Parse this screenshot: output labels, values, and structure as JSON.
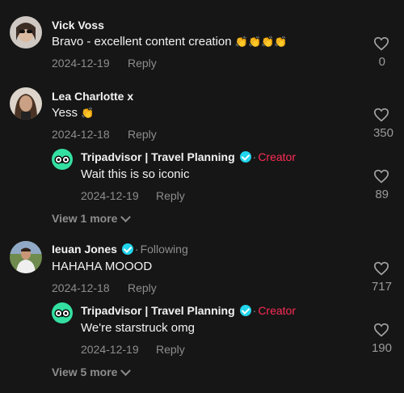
{
  "comments": [
    {
      "author": "Vick Voss",
      "text": "Bravo - excellent content creation ",
      "emoji": "👏👏👏👏",
      "date": "2024-12-19",
      "reply": "Reply",
      "likes": "0"
    },
    {
      "author": "Lea Charlotte x",
      "text": "Yess ",
      "emoji": "👏",
      "date": "2024-12-18",
      "reply": "Reply",
      "likes": "350",
      "replies": [
        {
          "author": "Tripadvisor | Travel Planning",
          "badge": "Creator",
          "text": "Wait this is so iconic",
          "date": "2024-12-19",
          "reply": "Reply",
          "likes": "89"
        }
      ],
      "view_more": "View 1 more"
    },
    {
      "author": "Ieuan Jones",
      "badge": "Following",
      "text": "HAHAHA MOOOD",
      "date": "2024-12-18",
      "reply": "Reply",
      "likes": "717",
      "replies": [
        {
          "author": "Tripadvisor | Travel Planning",
          "badge": "Creator",
          "text": "We're starstruck omg",
          "date": "2024-12-19",
          "reply": "Reply",
          "likes": "190"
        }
      ],
      "view_more": "View 5 more"
    }
  ],
  "colors": {
    "background": "#161616",
    "creator": "#fe2c55",
    "verified": "#20d5ec",
    "tripadvisor": "#34e0a1"
  }
}
